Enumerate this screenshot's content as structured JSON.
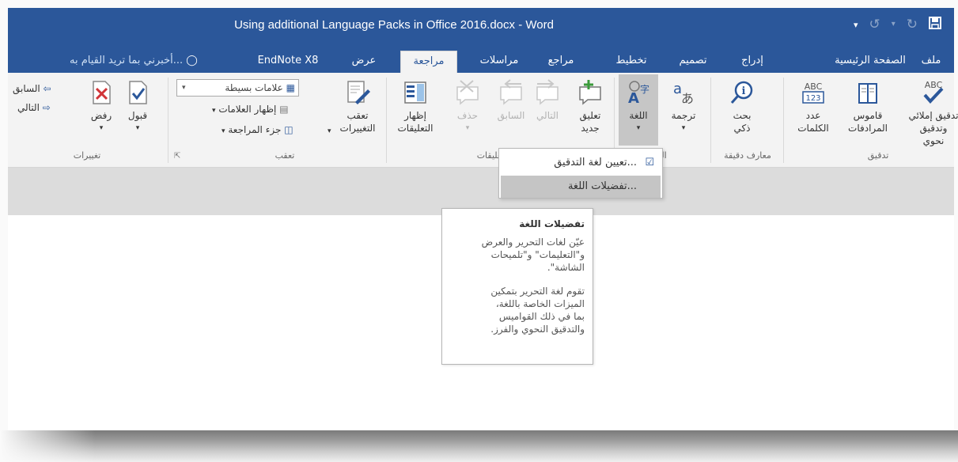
{
  "window": {
    "title": "Using additional Language Packs in Office 2016.docx - Word",
    "accent": "#2b579a"
  },
  "tabs": {
    "file": "ملف",
    "home": "الصفحة الرئيسية",
    "insert": "إدراج",
    "design": "تصميم",
    "layout": "تخطيط",
    "references": "مراجع",
    "mailings": "مراسلات",
    "review": "مراجعة",
    "view": "عرض",
    "endnote": "EndNote X8",
    "tell_me": "أخبرني بما تريد القيام به..."
  },
  "ribbon": {
    "proofing": {
      "label": "تدقيق",
      "spelling": [
        "تدقيق إملائي",
        "وتدقيق نحوي"
      ],
      "thesaurus": [
        "قاموس",
        "المرادفات"
      ],
      "word_count": [
        "عدد",
        "الكلمات"
      ],
      "spelling_icon_text": "ABC",
      "count_icon_top": "ABC",
      "count_icon_bottom": "123"
    },
    "insights": {
      "label": "معارف دقيقة",
      "smart_lookup": [
        "بحث",
        "ذكي"
      ]
    },
    "language": {
      "label": "اللـ",
      "translate": "ترجمة",
      "language": "اللغة"
    },
    "comments": {
      "label": "تعليقات",
      "new": [
        "تعليق",
        "جديد"
      ],
      "delete": "حذف",
      "previous": "السابق",
      "next": "التالي",
      "show": [
        "إظهار",
        "التعليقات"
      ]
    },
    "tracking": {
      "label": "تعقب",
      "track_changes": [
        "تعقب",
        "التغييرات"
      ],
      "markup_combo": "علامات بسيطة",
      "show_markup": "إظهار العلامات",
      "reviewing_pane": "جزء المراجعة"
    },
    "changes": {
      "label": "تغييرات",
      "accept": "قبول",
      "reject": "رفض",
      "previous": "السابق",
      "next": "التالي"
    }
  },
  "language_menu": {
    "set_proofing": "تعيين لغة التدقيق...",
    "preferences": "تفضيلات اللغة..."
  },
  "tooltip": {
    "title": "تفضيلات اللغة",
    "para1": [
      "عيّن لغات التحرير والعرض",
      "و\"التعليمات\" و\"تلميحات",
      "الشاشة\"."
    ],
    "para2": [
      "تقوم لغة التحرير بتمكين",
      "الميزات الخاصة باللغة،",
      "بما في ذلك القواميس",
      "والتدقيق النحوي والفرز."
    ]
  }
}
